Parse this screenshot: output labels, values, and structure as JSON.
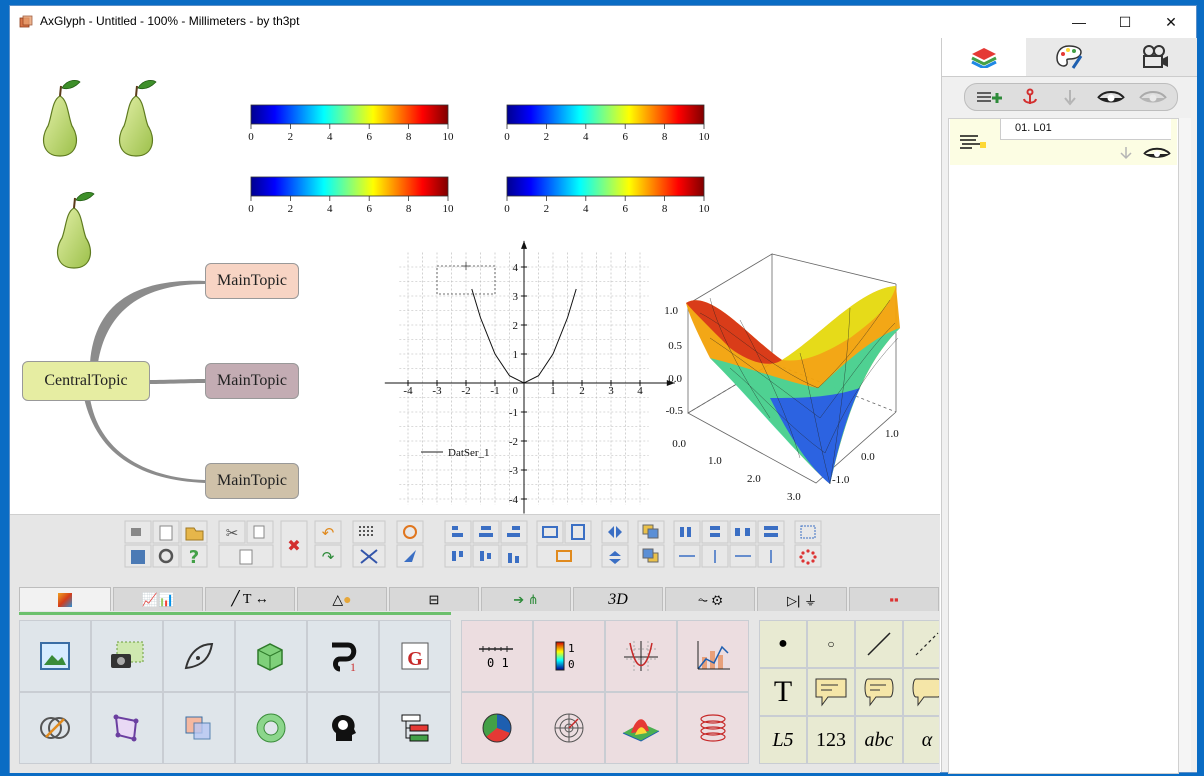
{
  "window": {
    "title": "AxGlyph - Untitled - 100% - Millimeters - by th3pt",
    "controls": {
      "minimize": "—",
      "maximize": "☐",
      "close": "✕"
    }
  },
  "canvas": {
    "colorbar": {
      "ticks": [
        "0",
        "2",
        "4",
        "6",
        "8",
        "10"
      ]
    },
    "mindmap": {
      "central": "CentralTopic",
      "topics": [
        "MainTopic",
        "MainTopic",
        "MainTopic"
      ]
    },
    "plot2d": {
      "x_ticks": [
        "-4",
        "-3",
        "-2",
        "-1",
        "1",
        "2",
        "3",
        "4"
      ],
      "y_ticks": [
        "4",
        "3",
        "2",
        "1",
        "-1",
        "-2",
        "-3",
        "-4"
      ],
      "origin_label": "0",
      "legend": "DatSer_1"
    },
    "plot3d": {
      "z_ticks": [
        "1.0",
        "0.5",
        "0.0",
        "-0.5",
        "0.0"
      ],
      "x_ticks": [
        "1.0",
        "2.0",
        "3.0"
      ],
      "y_ticks": [
        "1.0",
        "0.0",
        "-1.0"
      ]
    }
  },
  "chart_data": [
    {
      "type": "line",
      "x": [
        -1.8,
        -1.5,
        -1.0,
        -0.5,
        0,
        0.5,
        1.0,
        1.5,
        1.8
      ],
      "series": [
        {
          "name": "DatSer_1",
          "values": [
            3.24,
            2.25,
            1.0,
            0.25,
            0,
            0.25,
            1.0,
            2.25,
            3.24
          ]
        }
      ],
      "xlim": [
        -4,
        4
      ],
      "ylim": [
        -4,
        4
      ],
      "grid": true,
      "legend": "bottom-left"
    }
  ],
  "tabs": [
    {
      "name": "tab-general",
      "label": ""
    },
    {
      "name": "tab-charts",
      "label": ""
    },
    {
      "name": "tab-lines-text",
      "label": ""
    },
    {
      "name": "tab-shapes",
      "label": ""
    },
    {
      "name": "tab-flowchart",
      "label": ""
    },
    {
      "name": "tab-diagram",
      "label": ""
    },
    {
      "name": "tab-3d",
      "label": "3D"
    },
    {
      "name": "tab-circuit",
      "label": ""
    },
    {
      "name": "tab-electronics",
      "label": ""
    },
    {
      "name": "tab-misc",
      "label": ""
    }
  ],
  "palette3": {
    "row2": [
      "T",
      "",
      "",
      ""
    ],
    "row3": [
      "L5",
      "123",
      "abc",
      "α"
    ]
  },
  "layers": {
    "item_label": "01. L01"
  },
  "colors": {
    "accent_tab_active": "#f2f2f2",
    "layer_item_bg": "#fcfde3",
    "titlebar_bg": "#ffffff"
  }
}
